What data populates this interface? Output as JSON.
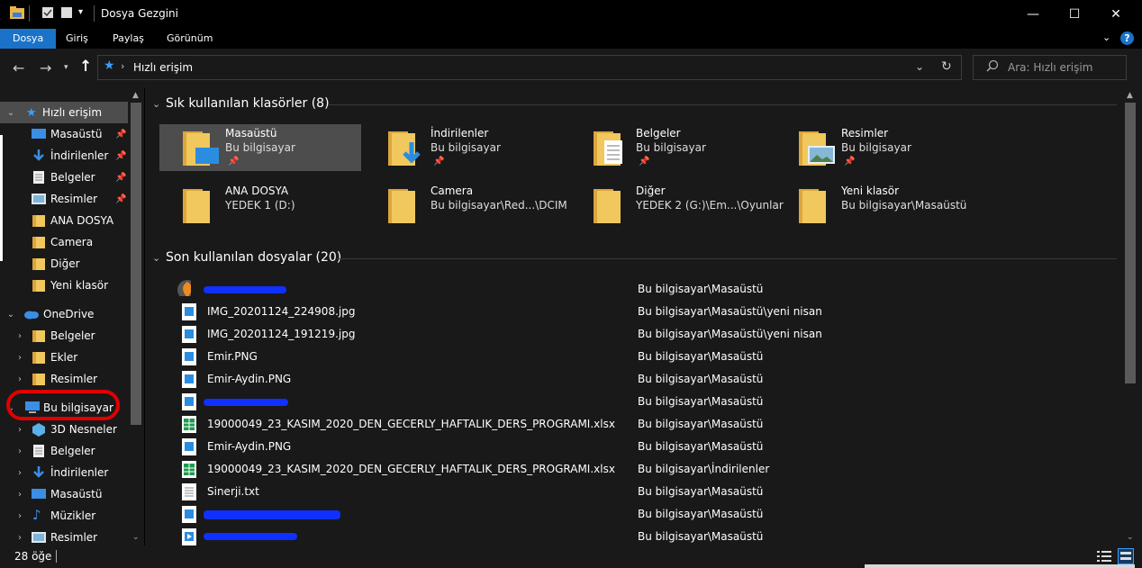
{
  "window": {
    "title": "Dosya Gezgini",
    "minimize": "—",
    "maximize": "☐",
    "close": "✕"
  },
  "ribbon": {
    "tabs": [
      "Dosya",
      "Giriş",
      "Paylaş",
      "Görünüm"
    ],
    "help": "?"
  },
  "address": {
    "location": "Hızlı erişim",
    "search_placeholder": "Ara: Hızlı erişim"
  },
  "nav_tree": {
    "quick_access": "Hızlı erişim",
    "quick_items": [
      {
        "label": "Masaüstü",
        "icon": "desktop-icon",
        "pinned": true
      },
      {
        "label": "İndirilenler",
        "icon": "download-icon",
        "pinned": true
      },
      {
        "label": "Belgeler",
        "icon": "documents-icon",
        "pinned": true
      },
      {
        "label": "Resimler",
        "icon": "pictures-icon",
        "pinned": true
      },
      {
        "label": "ANA DOSYA",
        "icon": "folder-icon",
        "pinned": false
      },
      {
        "label": "Camera",
        "icon": "folder-icon",
        "pinned": false
      },
      {
        "label": "Diğer",
        "icon": "folder-icon",
        "pinned": false
      },
      {
        "label": "Yeni klasör",
        "icon": "folder-icon",
        "pinned": false
      }
    ],
    "onedrive": "OneDrive",
    "onedrive_items": [
      "Belgeler",
      "Ekler",
      "Resimler"
    ],
    "this_pc": "Bu bilgisayar",
    "this_pc_items": [
      {
        "label": "3D Nesneler",
        "icon": "3d-objects-icon"
      },
      {
        "label": "Belgeler",
        "icon": "documents-icon"
      },
      {
        "label": "İndirilenler",
        "icon": "download-icon"
      },
      {
        "label": "Masaüstü",
        "icon": "desktop-icon"
      },
      {
        "label": "Müzikler",
        "icon": "music-icon"
      },
      {
        "label": "Resimler",
        "icon": "pictures-icon"
      }
    ]
  },
  "frequent": {
    "heading": "Sık kullanılan klasörler (8)",
    "folders": [
      {
        "name": "Masaüstü",
        "location": "Bu bilgisayar",
        "pinned": true,
        "overlay": "desktop"
      },
      {
        "name": "İndirilenler",
        "location": "Bu bilgisayar",
        "pinned": true,
        "overlay": "download"
      },
      {
        "name": "Belgeler",
        "location": "Bu bilgisayar",
        "pinned": true,
        "overlay": "document"
      },
      {
        "name": "Resimler",
        "location": "Bu bilgisayar",
        "pinned": true,
        "overlay": "picture"
      },
      {
        "name": "ANA DOSYA",
        "location": "YEDEK 1 (D:)",
        "pinned": false,
        "overlay": "none"
      },
      {
        "name": "Camera",
        "location": "Bu bilgisayar\\Red...\\DCIM",
        "pinned": false,
        "overlay": "none"
      },
      {
        "name": "Diğer",
        "location": "YEDEK 2 (G:)\\Em...\\Oyunlar",
        "pinned": false,
        "overlay": "none"
      },
      {
        "name": "Yeni klasör",
        "location": "Bu bilgisayar\\Masaüstü",
        "pinned": false,
        "overlay": "none"
      }
    ]
  },
  "recent": {
    "heading": "Son kullanılan dosyalar (20)",
    "files": [
      {
        "name": "",
        "path": "Bu bilgisayar\\Masaüstü",
        "icon": "fl-studio-icon",
        "redacted": true
      },
      {
        "name": "IMG_20201124_224908.jpg",
        "path": "Bu bilgisayar\\Masaüstü\\yeni nisan",
        "icon": "image-file-icon",
        "redacted": false
      },
      {
        "name": "IMG_20201124_191219.jpg",
        "path": "Bu bilgisayar\\Masaüstü\\yeni nisan",
        "icon": "image-file-icon",
        "redacted": false
      },
      {
        "name": "Emir.PNG",
        "path": "Bu bilgisayar\\Masaüstü",
        "icon": "image-file-icon",
        "redacted": false
      },
      {
        "name": "Emir-Aydin.PNG",
        "path": "Bu bilgisayar\\Masaüstü",
        "icon": "image-file-icon",
        "redacted": false
      },
      {
        "name": "",
        "path": "Bu bilgisayar\\Masaüstü",
        "icon": "image-file-icon",
        "redacted": true
      },
      {
        "name": "19000049_23_KASIM_2020_DEN_GECERLY_HAFTALIK_DERS_PROGRAMI.xlsx",
        "path": "Bu bilgisayar\\Masaüstü",
        "icon": "excel-file-icon",
        "redacted": false
      },
      {
        "name": "Emir-Aydin.PNG",
        "path": "Bu bilgisayar\\Masaüstü",
        "icon": "image-file-icon",
        "redacted": false
      },
      {
        "name": "19000049_23_KASIM_2020_DEN_GECERLY_HAFTALIK_DERS_PROGRAMI.xlsx",
        "path": "Bu bilgisayar\\İndirilenler",
        "icon": "excel-file-icon",
        "redacted": false
      },
      {
        "name": "Sinerji.txt",
        "path": "Bu bilgisayar\\Masaüstü",
        "icon": "text-file-icon",
        "redacted": false
      },
      {
        "name": "",
        "path": "Bu bilgisayar\\Masaüstü",
        "icon": "image-file-icon",
        "redacted": true
      },
      {
        "name": "",
        "path": "Bu bilgisayar\\Masaüstü",
        "icon": "video-file-icon",
        "redacted": true
      }
    ]
  },
  "status": {
    "count": "28 öğe"
  },
  "colors": {
    "accent": "#1a73c9",
    "highlight_circle": "#e00000",
    "redaction": "#1030ff"
  }
}
